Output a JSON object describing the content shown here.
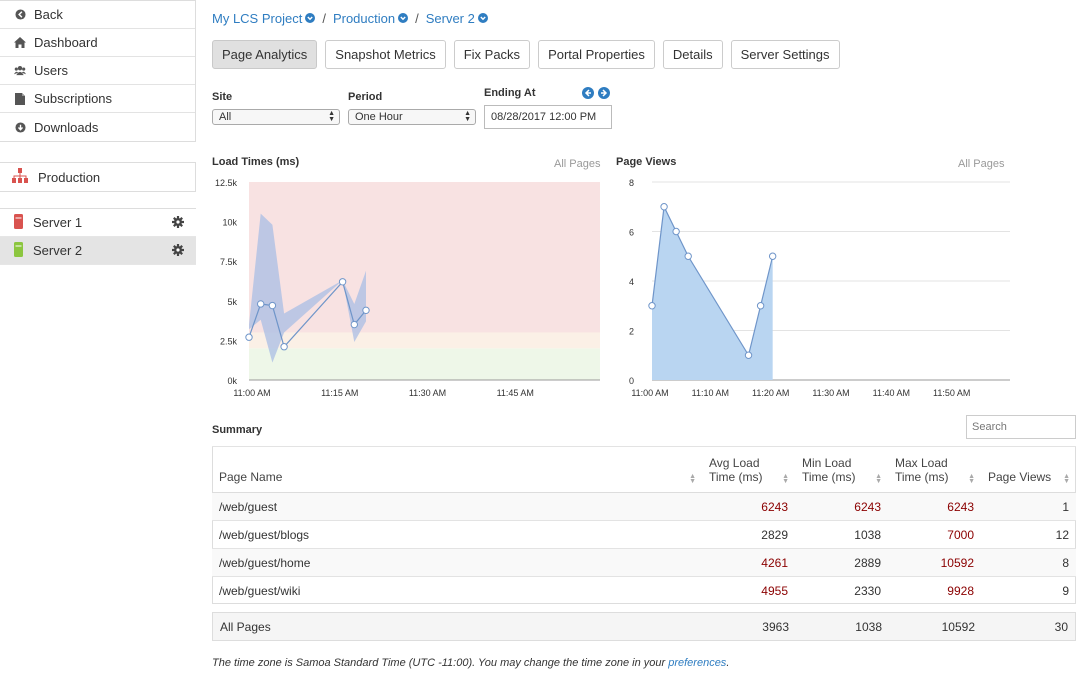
{
  "sidebar": {
    "items": [
      {
        "label": "Back",
        "icon": "back-arrow-icon"
      },
      {
        "label": "Dashboard",
        "icon": "home-icon"
      },
      {
        "label": "Users",
        "icon": "users-icon"
      },
      {
        "label": "Subscriptions",
        "icon": "document-icon"
      },
      {
        "label": "Downloads",
        "icon": "download-icon"
      }
    ],
    "environment": {
      "label": "Production",
      "icon": "cluster-icon"
    },
    "servers": [
      {
        "label": "Server 1",
        "status_color": "#d9534f"
      },
      {
        "label": "Server 2",
        "status_color": "#8cc63f"
      }
    ]
  },
  "breadcrumb": {
    "project": "My LCS Project",
    "environment": "Production",
    "server": "Server 2",
    "separator": "/"
  },
  "tabs": [
    "Page Analytics",
    "Snapshot Metrics",
    "Fix Packs",
    "Portal Properties",
    "Details",
    "Server Settings"
  ],
  "filters": {
    "site_label": "Site",
    "site_value": "All",
    "period_label": "Period",
    "period_value": "One Hour",
    "ending_label": "Ending At",
    "ending_value": "08/28/2017  12:00 PM"
  },
  "charts": {
    "load_title": "Load Times (ms)",
    "load_sub": "All Pages",
    "views_title": "Page Views",
    "views_sub": "All Pages"
  },
  "chart_data": [
    {
      "type": "line",
      "title": "Load Times (ms)",
      "ylim": [
        0,
        12500
      ],
      "yticks": [
        "0k",
        "2.5k",
        "5k",
        "7.5k",
        "10k",
        "12.5k"
      ],
      "xticks": [
        "11:00 AM",
        "11:15 AM",
        "11:30 AM",
        "11:45 AM"
      ],
      "x_minutes": [
        0,
        2,
        4,
        6,
        16,
        18,
        20
      ],
      "series": [
        {
          "values": [
            2700,
            4800,
            4700,
            2100,
            6200,
            3500,
            4400
          ]
        }
      ],
      "range_band": {
        "low": [
          3200,
          3800,
          1100,
          3000,
          6300,
          2400,
          3700
        ],
        "high": [
          3500,
          10500,
          9800,
          4200,
          6300,
          4800,
          6900
        ]
      },
      "zones": [
        {
          "from": 0,
          "to": 2000,
          "color": "#eef7e8"
        },
        {
          "from": 2000,
          "to": 3000,
          "color": "#fbf0e6"
        },
        {
          "from": 3000,
          "to": 12500,
          "color": "#f8e2e2"
        }
      ]
    },
    {
      "type": "area",
      "title": "Page Views",
      "ylim": [
        0,
        8
      ],
      "yticks": [
        "0",
        "2",
        "4",
        "6",
        "8"
      ],
      "xticks": [
        "11:00 AM",
        "11:10 AM",
        "11:20 AM",
        "11:30 AM",
        "11:40 AM",
        "11:50 AM"
      ],
      "x_minutes": [
        0,
        2,
        4,
        6,
        16,
        18,
        20
      ],
      "series": [
        {
          "values": [
            3,
            7,
            6,
            5,
            1,
            3,
            5
          ]
        }
      ]
    }
  ],
  "summary": {
    "title": "Summary",
    "search_placeholder": "Search",
    "headers": [
      "Page Name",
      "Avg Load Time (ms)",
      "Min Load Time (ms)",
      "Max Load Time (ms)",
      "Page Views"
    ],
    "header_lines": [
      [
        "Page Name"
      ],
      [
        "Avg Load",
        "Time (ms)"
      ],
      [
        "Min Load",
        "Time (ms)"
      ],
      [
        "Max Load",
        "Time (ms)"
      ],
      [
        "Page Views"
      ]
    ],
    "rows": [
      {
        "page": "/web/guest",
        "avg": "6243",
        "min": "6243",
        "max": "6243",
        "views": "1",
        "red": [
          true,
          true,
          true
        ]
      },
      {
        "page": "/web/guest/blogs",
        "avg": "2829",
        "min": "1038",
        "max": "7000",
        "views": "12",
        "red": [
          false,
          false,
          true
        ]
      },
      {
        "page": "/web/guest/home",
        "avg": "4261",
        "min": "2889",
        "max": "10592",
        "views": "8",
        "red": [
          true,
          false,
          true
        ]
      },
      {
        "page": "/web/guest/wiki",
        "avg": "4955",
        "min": "2330",
        "max": "9928",
        "views": "9",
        "red": [
          true,
          false,
          true
        ]
      }
    ],
    "total": {
      "label": "All Pages",
      "avg": "3963",
      "min": "1038",
      "max": "10592",
      "views": "30"
    }
  },
  "footnote": {
    "text": "The time zone is Samoa Standard Time (UTC -11:00). You may change the time zone in your ",
    "link": "preferences",
    "end": "."
  },
  "colors": {
    "accent": "#2f7dc1",
    "alert_red": "#8b0000",
    "series_blue": "#9fc5ea"
  }
}
